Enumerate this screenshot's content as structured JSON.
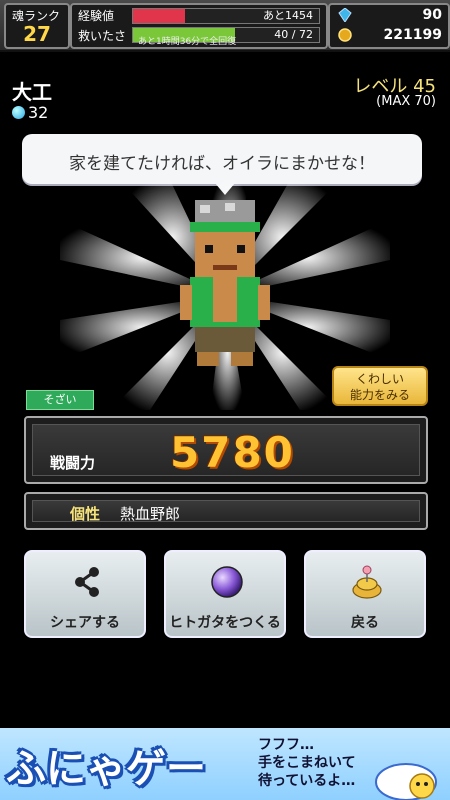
{
  "topbar": {
    "rank_label": "魂ランク",
    "rank_value": "27",
    "exp_label": "経験値",
    "exp_text": "あと1454",
    "exp_progress": 0.28,
    "rescue_label": "救いたさ",
    "rescue_text": "40 / 72",
    "rescue_progress": 0.55,
    "rescue_sub": "あと1時間36分で全回復",
    "gems": "90",
    "coins": "221199",
    "gem_icon": "blue-crystal-icon",
    "coin_icon": "gold-coin-icon"
  },
  "character": {
    "job": "大工",
    "gem_count": "32",
    "level": "レベル 45",
    "level_max": "(MAX 70)",
    "speech": "家を建てたければ、オイラにまかせな！",
    "tag": "そざい",
    "detail_button": "くわしい\n能力をみる",
    "power_label": "戦闘力",
    "power_value": "5780",
    "trait_label": "個性",
    "trait_value": "熱血野郎"
  },
  "actions": {
    "share": "シェアする",
    "hitogata": "ヒトガタをつくる",
    "back": "戻る"
  },
  "ad": {
    "logo": "ふにゃゲー",
    "copy_line1": "フフフ…",
    "copy_line2": "手をこまねいて",
    "copy_line3": "待っているよ…"
  },
  "colors": {
    "exp_bar": "#e0354a",
    "rescue_bar": "#7ac83a",
    "accent_gold": "#ffc233",
    "tag_green": "#2faa5a"
  }
}
